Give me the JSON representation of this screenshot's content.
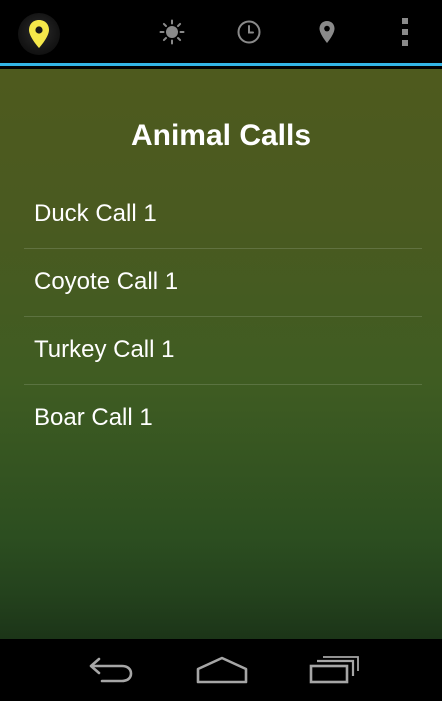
{
  "action_bar": {
    "icons": [
      "map-pin-app-icon",
      "brightness-icon",
      "clock-icon",
      "location-pin-icon",
      "overflow-menu-icon"
    ],
    "accent_color": "#33b5e5",
    "app_icon_color": "#f5e84a"
  },
  "main": {
    "title": "Animal Calls",
    "items": [
      {
        "label": "Duck Call 1"
      },
      {
        "label": "Coyote Call 1"
      },
      {
        "label": "Turkey Call 1"
      },
      {
        "label": "Boar Call 1"
      }
    ]
  },
  "nav_bar": {
    "icons": [
      "back-icon",
      "home-icon",
      "recent-apps-icon"
    ]
  }
}
